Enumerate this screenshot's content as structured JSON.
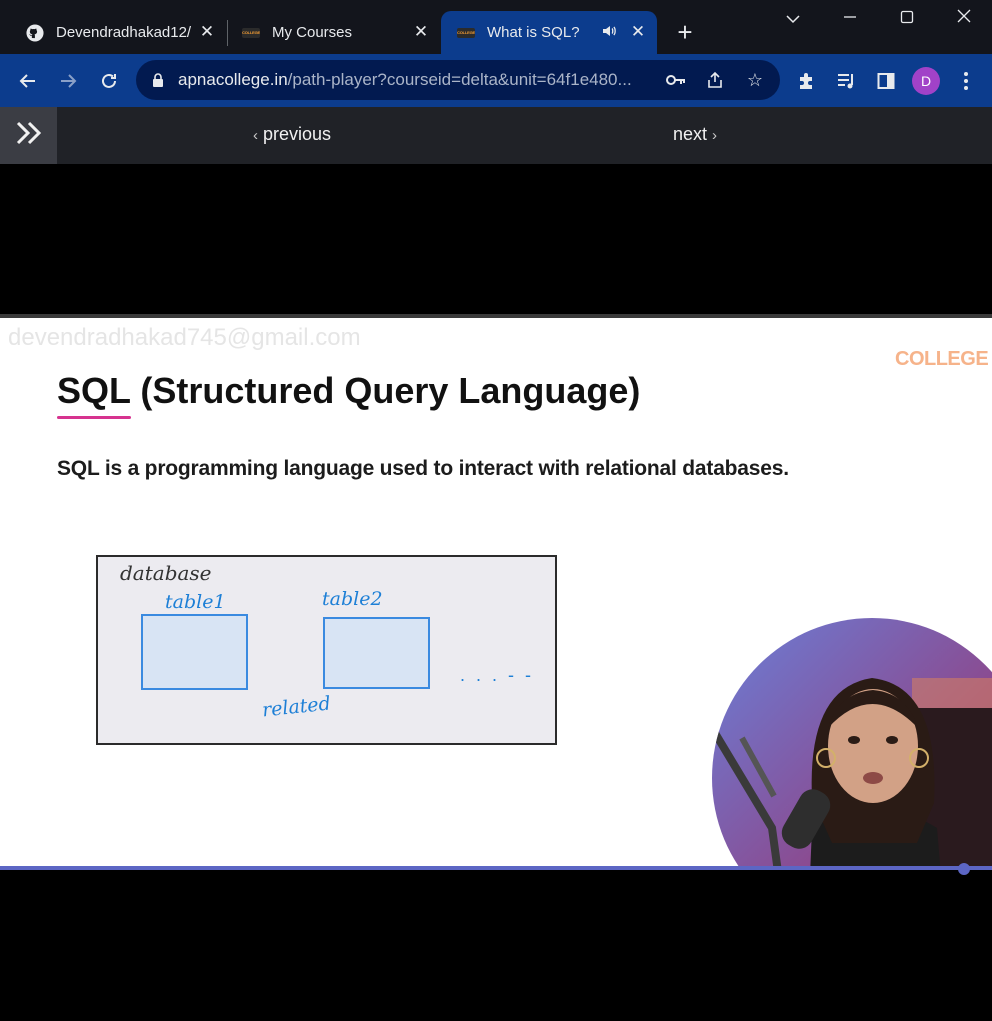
{
  "browser": {
    "tabs": [
      {
        "title": "Devendradhakad12/",
        "icon": "github-icon"
      },
      {
        "title": "My Courses",
        "icon": "college-logo-icon"
      },
      {
        "title": "What is SQL?",
        "icon": "college-logo-icon",
        "audio": true,
        "active": true
      }
    ],
    "favicon_text": "COLLEGE",
    "url_host": "apnacollege.in",
    "url_path": "/path-player?courseid=delta&unit=64f1e480...",
    "profile_initial": "D",
    "accent_color": "#0c3c8d"
  },
  "course_nav": {
    "previous_label": "previous",
    "next_label": "next"
  },
  "video": {
    "watermark": "devendradhakad745@gmail.com",
    "brand": "COLLEGE",
    "slide_title": "SQL (Structured Query Language)",
    "slide_subtitle": "SQL is a programming language used to interact with relational databases.",
    "diagram": {
      "database_label": "database",
      "table1_label": "table1",
      "table2_label": "table2",
      "relation_label": "related",
      "more_label": ". . .  - -"
    },
    "progress_percent": 97,
    "progress_color": "#5c66c4"
  }
}
